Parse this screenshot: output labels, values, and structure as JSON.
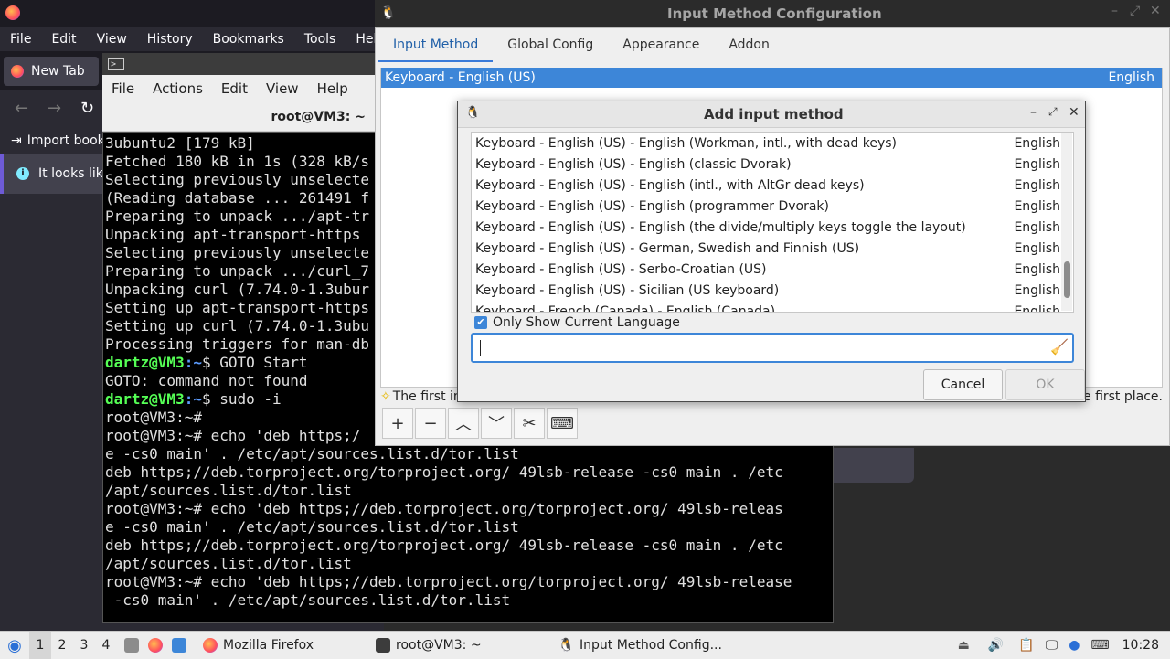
{
  "firefox": {
    "menu": [
      "File",
      "Edit",
      "View",
      "History",
      "Bookmarks",
      "Tools",
      "Help"
    ],
    "tab_label": "New Tab",
    "bookmark_label": "Import book",
    "notice_text": "It looks lik"
  },
  "terminal": {
    "menu": [
      "File",
      "Actions",
      "Edit",
      "View",
      "Help"
    ],
    "title": "root@VM3: ~",
    "lines": [
      {
        "t": "3ubuntu2 [179 kB]"
      },
      {
        "t": "Fetched 180 kB in 1s (328 kB/s"
      },
      {
        "t": "Selecting previously unselecte"
      },
      {
        "t": "(Reading database ... 261491 f"
      },
      {
        "t": "Preparing to unpack .../apt-tr"
      },
      {
        "t": "Unpacking apt-transport-https"
      },
      {
        "t": "Selecting previously unselecte"
      },
      {
        "t": "Preparing to unpack .../curl_7"
      },
      {
        "t": "Unpacking curl (7.74.0-1.3ubur"
      },
      {
        "t": "Setting up apt-transport-https"
      },
      {
        "t": "Setting up curl (7.74.0-1.3ubu"
      },
      {
        "t": "Processing triggers for man-db"
      },
      {
        "u": "dartz@VM3",
        "p": ":~",
        "t": "$ GOTO Start"
      },
      {
        "t": "GOTO: command not found"
      },
      {
        "u": "dartz@VM3",
        "p": ":~",
        "t": "$ sudo -i"
      },
      {
        "t": "root@VM3:~#"
      },
      {
        "t": "root@VM3:~# echo 'deb https;/"
      },
      {
        "t": "e -cs0 main' . /etc/apt/sources.list.d/tor.list"
      },
      {
        "t": "deb https;//deb.torproject.org/torproject.org/ 49lsb-release -cs0 main . /etc"
      },
      {
        "t": "/apt/sources.list.d/tor.list"
      },
      {
        "t": "root@VM3:~# echo 'deb https;//deb.torproject.org/torproject.org/ 49lsb-releas"
      },
      {
        "t": "e -cs0 main' . /etc/apt/sources.list.d/tor.list"
      },
      {
        "t": "deb https;//deb.torproject.org/torproject.org/ 49lsb-release -cs0 main . /etc"
      },
      {
        "t": "/apt/sources.list.d/tor.list"
      },
      {
        "t": "root@VM3:~# echo 'deb https;//deb.torproject.org/torproject.org/ 49lsb-release"
      },
      {
        "t": " -cs0 main' . /etc/apt/sources.list.d/tor.list"
      }
    ]
  },
  "imc": {
    "title": "Input Method Configuration",
    "tabs": [
      "Input Method",
      "Global Config",
      "Appearance",
      "Addon"
    ],
    "selected_method": "Keyboard - English (US)",
    "selected_lang": "English",
    "hint_left": "The first in",
    "hint_right": "e first place.",
    "toolbar": [
      "+",
      "−",
      "︿",
      "﹀",
      "✂",
      "⌨"
    ]
  },
  "dialog": {
    "title": "Add input method",
    "rows": [
      {
        "name": "Keyboard - English (US) - English (Workman, intl., with dead keys)",
        "lang": "English"
      },
      {
        "name": "Keyboard - English (US) - English (classic Dvorak)",
        "lang": "English"
      },
      {
        "name": "Keyboard - English (US) - English (intl., with AltGr dead keys)",
        "lang": "English"
      },
      {
        "name": "Keyboard - English (US) - English (programmer Dvorak)",
        "lang": "English"
      },
      {
        "name": "Keyboard - English (US) - English (the divide/multiply keys toggle the layout)",
        "lang": "English"
      },
      {
        "name": "Keyboard - English (US) - German, Swedish and Finnish (US)",
        "lang": "English"
      },
      {
        "name": "Keyboard - English (US) - Serbo-Croatian (US)",
        "lang": "English"
      },
      {
        "name": "Keyboard - English (US) - Sicilian (US keyboard)",
        "lang": "English"
      },
      {
        "name": "Keyboard - French (Canada) - English (Canada)",
        "lang": "English"
      }
    ],
    "checkbox_label": "Only Show Current Language",
    "checkbox_checked": true,
    "search_value": "",
    "cancel_label": "Cancel",
    "ok_label": "OK"
  },
  "taskbar": {
    "workspaces": [
      "1",
      "2",
      "3",
      "4"
    ],
    "tasks": [
      "Mozilla Firefox",
      "root@VM3: ~",
      "Input Method Config..."
    ],
    "clock": "10:28"
  },
  "colors": {
    "accent": "#3d86d8",
    "terminal_user": "#55ff55",
    "terminal_path": "#5c9cff"
  }
}
